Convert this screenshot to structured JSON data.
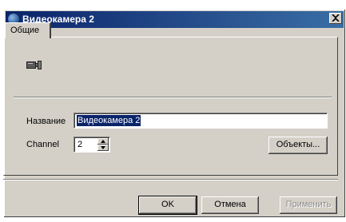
{
  "window": {
    "title": "Видеокамера 2"
  },
  "tabs": [
    {
      "label": "Общие",
      "active": true
    }
  ],
  "form": {
    "name_label": "Название",
    "name_value": "Видеокамера 2",
    "channel_label": "Channel",
    "channel_value": "2",
    "objects_button": "Объекты..."
  },
  "footer": {
    "ok_label": "OK",
    "cancel_label": "Отмена",
    "apply_label": "Применить",
    "apply_enabled": false
  },
  "colors": {
    "title_bar": "#0a246a",
    "dialog_bg": "#d4d0c8",
    "selection": "#0a246a"
  },
  "icons": {
    "app": "camera-app-icon",
    "close": "close-icon",
    "camera": "video-camera-icon",
    "spin_up": "arrow-up-icon",
    "spin_down": "arrow-down-icon"
  }
}
